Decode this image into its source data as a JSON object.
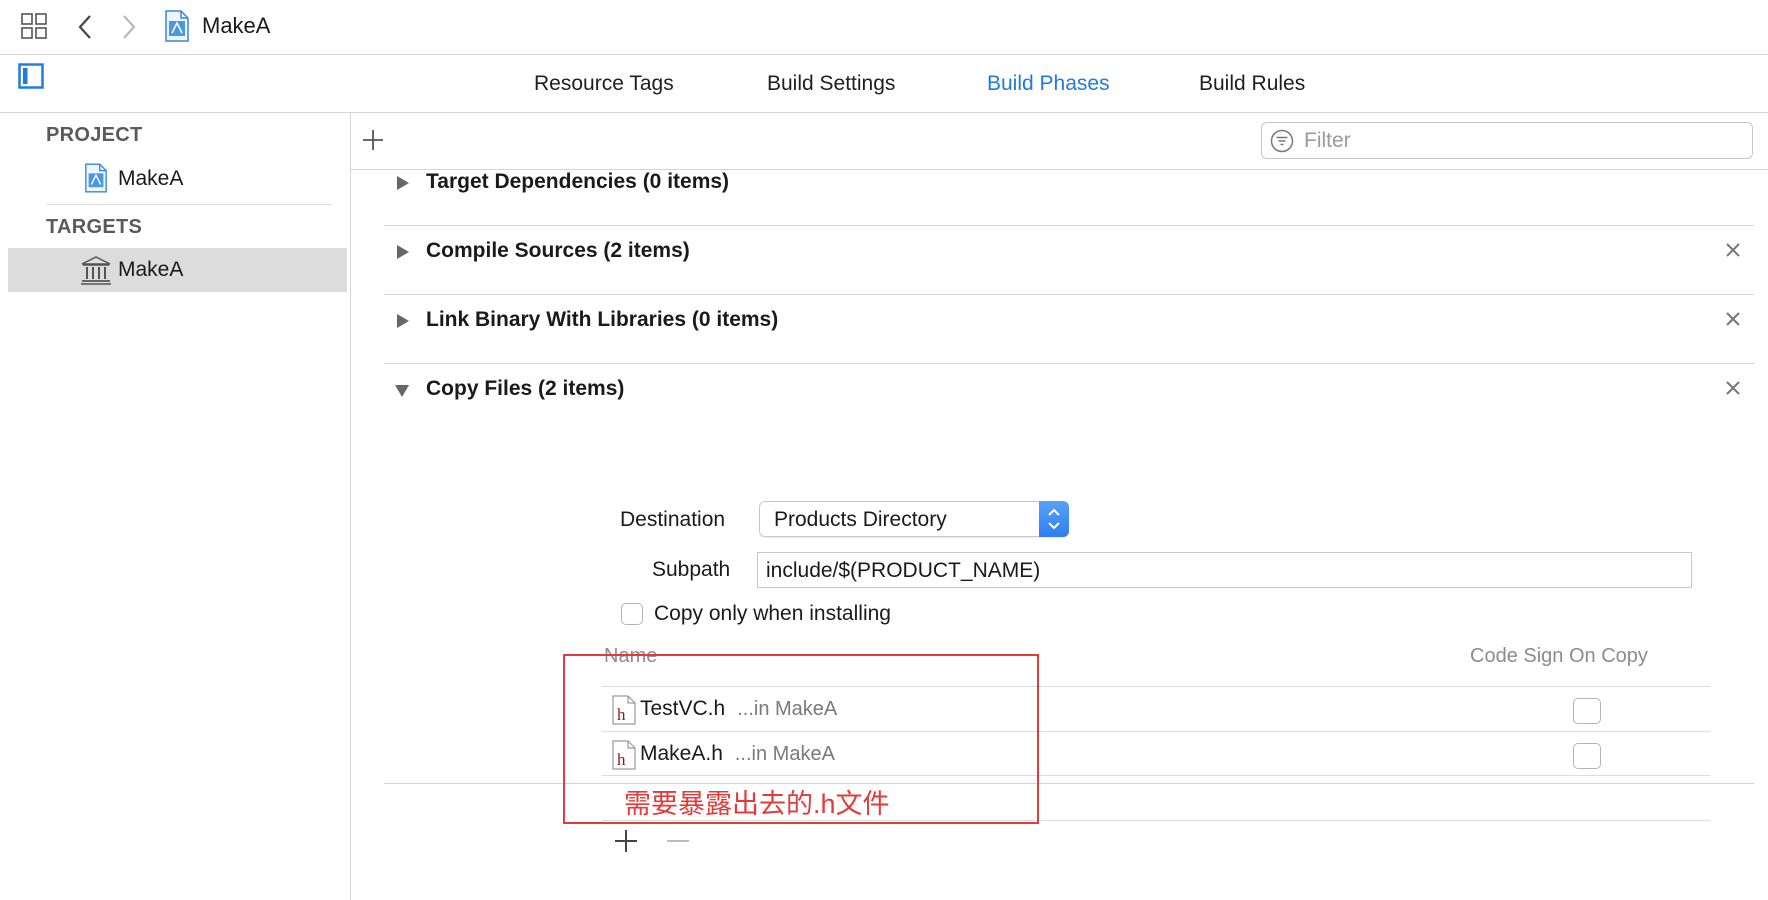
{
  "window": {
    "breadcrumb_project": "MakeA"
  },
  "tabs": [
    {
      "label": "Resource Tags",
      "active": false
    },
    {
      "label": "Build Settings",
      "active": false
    },
    {
      "label": "Build Phases",
      "active": true
    },
    {
      "label": "Build Rules",
      "active": false
    }
  ],
  "sidebar": {
    "project_header": "PROJECT",
    "project_item": "MakeA",
    "targets_header": "TARGETS",
    "target_item": "MakeA"
  },
  "toolbar": {
    "filter_placeholder": "Filter"
  },
  "phases": [
    {
      "title": "Target Dependencies",
      "count": "(0 items)",
      "expanded": false,
      "closable": false
    },
    {
      "title": "Compile Sources",
      "count": "(2 items)",
      "expanded": false,
      "closable": true
    },
    {
      "title": "Link Binary With Libraries",
      "count": "(0 items)",
      "expanded": false,
      "closable": true
    },
    {
      "title": "Copy Files",
      "count": "(2 items)",
      "expanded": true,
      "closable": true
    }
  ],
  "copy_files": {
    "destination_label": "Destination",
    "destination_value": "Products Directory",
    "subpath_label": "Subpath",
    "subpath_value": "include/$(PRODUCT_NAME)",
    "install_only_label": "Copy only when installing",
    "install_only_checked": false,
    "col_name": "Name",
    "col_codesign": "Code Sign On Copy",
    "files": [
      {
        "name": "TestVC.h",
        "location": "...in MakeA",
        "code_sign": false
      },
      {
        "name": "MakeA.h",
        "location": "...in MakeA",
        "code_sign": false
      }
    ]
  },
  "annotation": {
    "text": "需要暴露出去的.h文件",
    "color": "#e43a3a"
  },
  "colors": {
    "accent": "#1e7be3",
    "selection": "#dcdcdc",
    "separator": "#d4d4d4"
  },
  "icons": {
    "grid": "grid-icon",
    "back": "chevron-left-icon",
    "forward": "chevron-right-icon",
    "project_file": "xcodeproj-icon",
    "sidebar_toggle": "sidebar-toggle-icon",
    "target": "target-building-icon",
    "add": "plus-icon",
    "remove": "minus-icon",
    "filter": "filter-icon",
    "close": "close-icon",
    "header_file": "h-file-icon"
  }
}
